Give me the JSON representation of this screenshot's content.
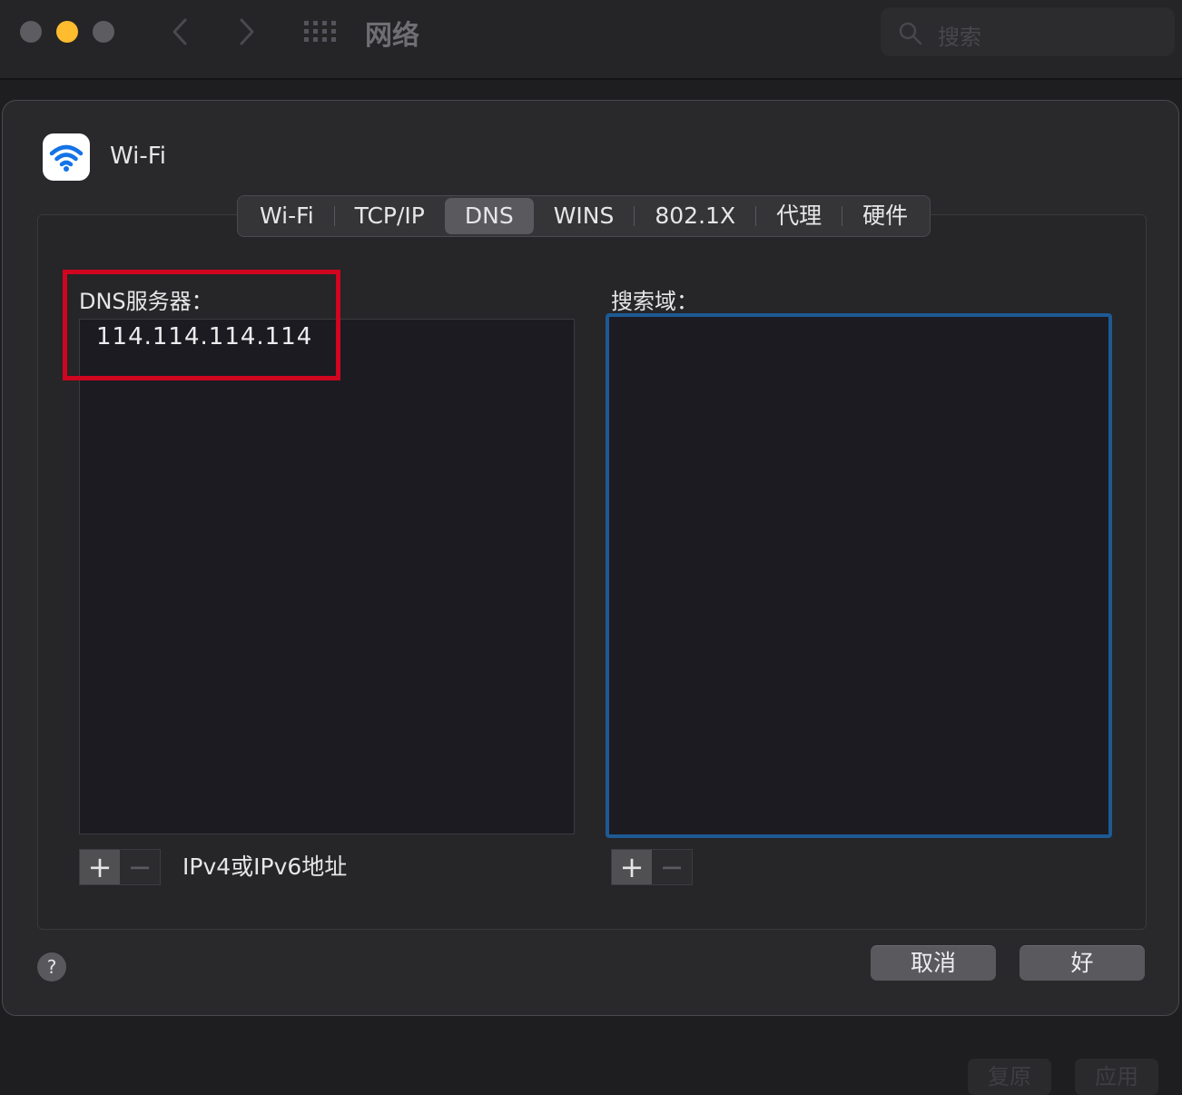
{
  "window": {
    "title": "网络",
    "search_placeholder": "搜索",
    "traffic_lights": {
      "close": "#5d5c60",
      "minimize": "#febc2e",
      "zoom": "#5d5c60"
    },
    "icons": [
      "back-chevron-icon",
      "forward-chevron-icon",
      "grid-icon",
      "search-icon"
    ]
  },
  "sheet": {
    "service_name": "Wi-Fi",
    "service_icon": "wifi-icon",
    "tabs": [
      {
        "label": "Wi-Fi",
        "active": false
      },
      {
        "label": "TCP/IP",
        "active": false
      },
      {
        "label": "DNS",
        "active": true
      },
      {
        "label": "WINS",
        "active": false
      },
      {
        "label": "802.1X",
        "active": false
      },
      {
        "label": "代理",
        "active": false
      },
      {
        "label": "硬件",
        "active": false
      }
    ],
    "dns": {
      "label": "DNS服务器：",
      "servers": [
        "114.114.114.114"
      ],
      "hint": "IPv4或IPv6地址",
      "highlight_color": "#d0051f"
    },
    "search_domains": {
      "label": "搜索域：",
      "domains": [],
      "focus_color": "#1d5a94"
    },
    "add_symbol": "+",
    "remove_symbol": "−",
    "help_symbol": "?",
    "cancel_label": "取消",
    "ok_label": "好"
  },
  "background_buttons": {
    "revert_label": "复原",
    "apply_label": "应用"
  }
}
